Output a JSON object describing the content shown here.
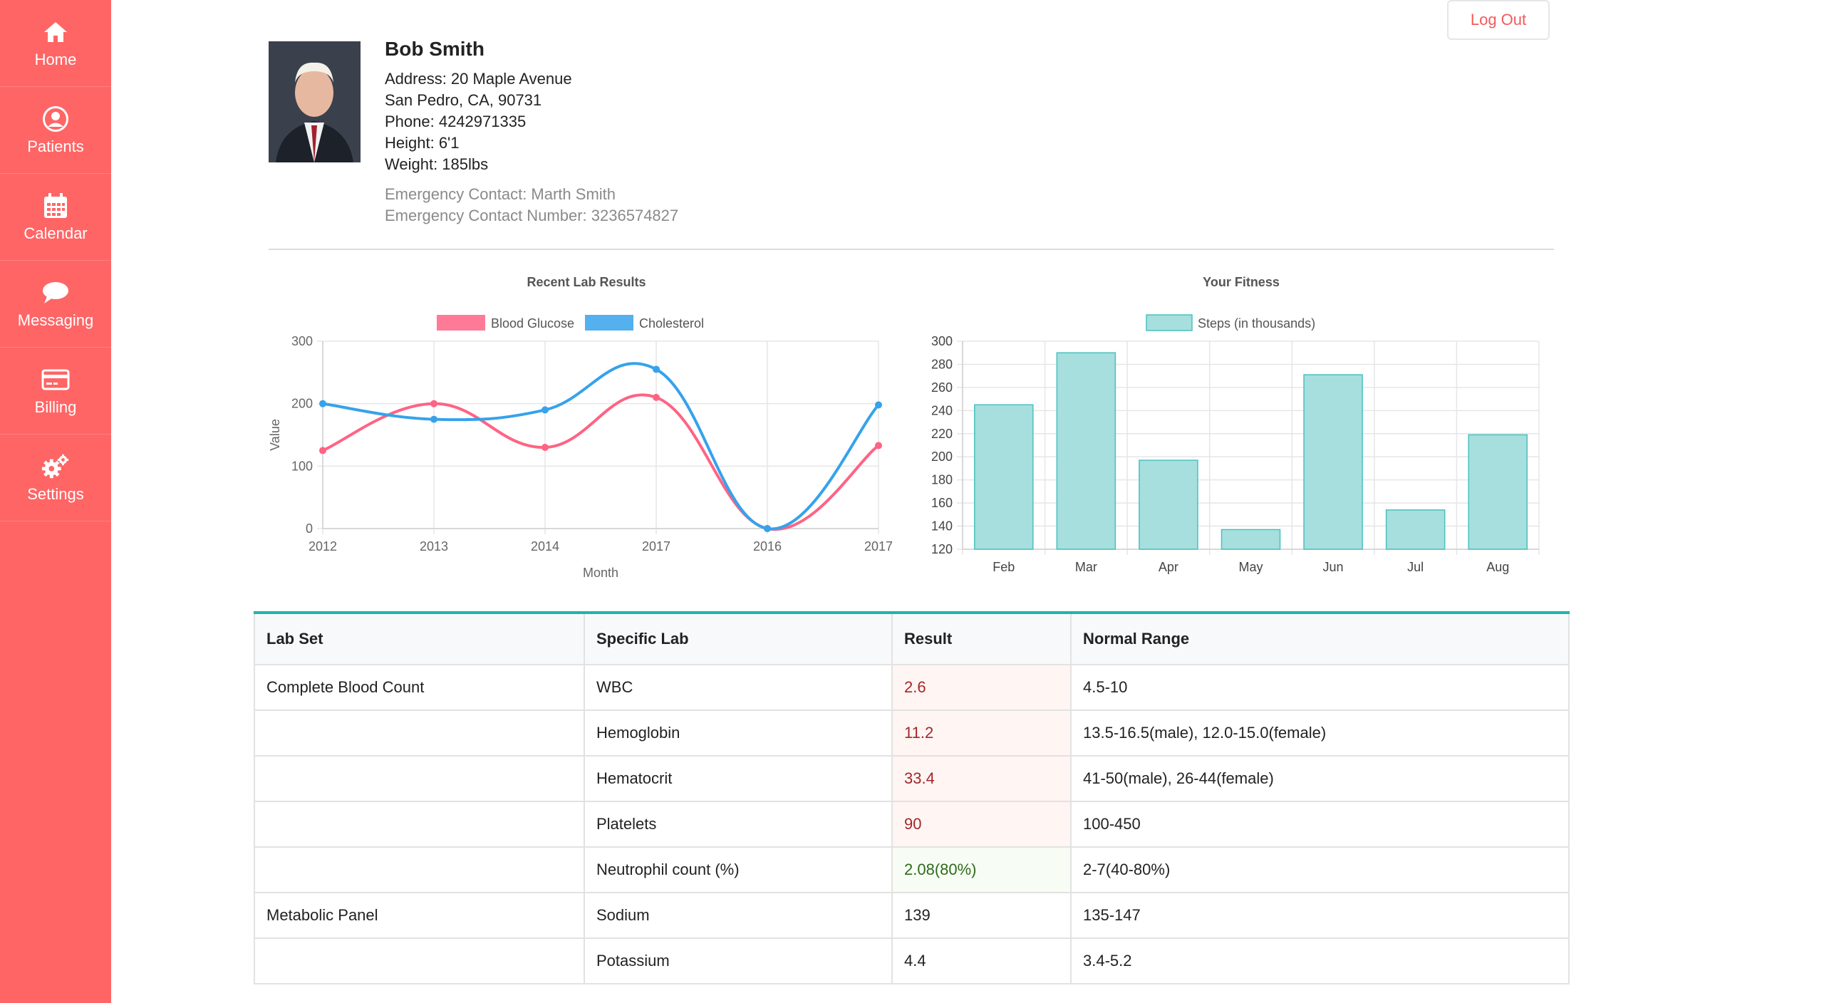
{
  "sidebar": {
    "items": [
      {
        "label": "Home",
        "icon": "home-icon"
      },
      {
        "label": "Patients",
        "icon": "user-circle-icon"
      },
      {
        "label": "Calendar",
        "icon": "calendar-icon"
      },
      {
        "label": "Messaging",
        "icon": "chat-bubble-icon"
      },
      {
        "label": "Billing",
        "icon": "credit-card-icon"
      },
      {
        "label": "Settings",
        "icon": "gears-icon"
      }
    ]
  },
  "header": {
    "logout_label": "Log Out"
  },
  "patient": {
    "name": "Bob Smith",
    "address": "Address: 20 Maple Avenue",
    "city": "San Pedro, CA, 90731",
    "phone": "Phone: 4242971335",
    "height": "Height: 6'1",
    "weight": "Weight: 185lbs",
    "emergency_contact": "Emergency Contact: Marth Smith",
    "emergency_number": "Emergency Contact Number: 3236574827"
  },
  "colors": {
    "sidebar": "#ff6565",
    "glucose": "#ff6384",
    "cholesterol": "#36a2eb",
    "steps_fill": "#a6dfdd",
    "steps_stroke": "#4bc0c0",
    "accent": "#1fb5a8"
  },
  "chart_data": [
    {
      "type": "line",
      "title": "Recent Lab Results",
      "xlabel": "Month",
      "ylabel": "Value",
      "categories": [
        "2012",
        "2013",
        "2014",
        "2017",
        "2016",
        "2017"
      ],
      "ylim": [
        0,
        300
      ],
      "yticks": [
        "0",
        "100",
        "200",
        "300"
      ],
      "grid": true,
      "legend": "top",
      "series": [
        {
          "name": "Blood Glucose",
          "values": [
            125,
            200,
            130,
            210,
            0,
            133
          ]
        },
        {
          "name": "Cholesterol",
          "values": [
            200,
            175,
            190,
            255,
            0,
            198
          ]
        }
      ]
    },
    {
      "type": "bar",
      "title": "Your Fitness",
      "categories": [
        "Feb",
        "Mar",
        "Apr",
        "May",
        "Jun",
        "Jul",
        "Aug"
      ],
      "ylim": [
        120,
        300
      ],
      "yticks": [
        "120",
        "140",
        "160",
        "180",
        "200",
        "220",
        "240",
        "260",
        "280",
        "300"
      ],
      "grid": true,
      "legend": "top",
      "series": [
        {
          "name": "Steps (in thousands)",
          "values": [
            245,
            290,
            197,
            137,
            271,
            154,
            219
          ]
        }
      ]
    }
  ],
  "lab_table": {
    "headers": [
      "Lab Set",
      "Specific Lab",
      "Result",
      "Normal Range"
    ],
    "rows": [
      {
        "set": "Complete Blood Count",
        "lab": "WBC",
        "result": "2.6",
        "range": "4.5-10",
        "status": "bad"
      },
      {
        "set": "",
        "lab": "Hemoglobin",
        "result": "11.2",
        "range": "13.5-16.5(male), 12.0-15.0(female)",
        "status": "bad"
      },
      {
        "set": "",
        "lab": "Hematocrit",
        "result": "33.4",
        "range": "41-50(male), 26-44(female)",
        "status": "bad"
      },
      {
        "set": "",
        "lab": "Platelets",
        "result": "90",
        "range": "100-450",
        "status": "bad"
      },
      {
        "set": "",
        "lab": "Neutrophil count (%)",
        "result": "2.08(80%)",
        "range": "2-7(40-80%)",
        "status": "good"
      },
      {
        "set": "Metabolic Panel",
        "lab": "Sodium",
        "result": "139",
        "range": "135-147",
        "status": "normal"
      },
      {
        "set": "",
        "lab": "Potassium",
        "result": "4.4",
        "range": "3.4-5.2",
        "status": "normal"
      }
    ]
  }
}
